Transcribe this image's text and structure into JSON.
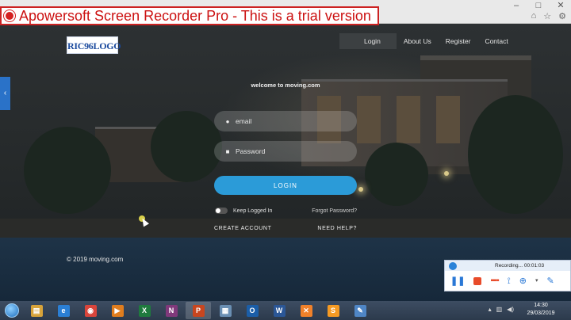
{
  "banner": {
    "text": "Apowersoft Screen Recorder Pro - This is a trial version"
  },
  "site": {
    "logo": "RIC96LOGO",
    "nav": [
      "Login",
      "About Us",
      "Register",
      "Contact"
    ],
    "welcome": "welcome to moving.com",
    "email_placeholder": "email",
    "password_placeholder": "Password",
    "login_label": "LOGIN",
    "keep_logged_in": "Keep Logged In",
    "forgot_password": "Forgot Password?",
    "create_account": "CREATE ACCOUNT",
    "need_help": "NEED HELP?",
    "copyright": "© 2019 moving.com"
  },
  "recorder": {
    "status": "Recording... 00:01:03"
  },
  "taskbar": {
    "apps": [
      {
        "name": "explorer-icon",
        "glyph": "▤",
        "color": "#d7a33a"
      },
      {
        "name": "ie-icon",
        "glyph": "e",
        "color": "#2b7fd4"
      },
      {
        "name": "chrome-icon",
        "glyph": "◉",
        "color": "#d9453b"
      },
      {
        "name": "media-player-icon",
        "glyph": "▶",
        "color": "#e07d1e"
      },
      {
        "name": "excel-icon",
        "glyph": "X",
        "color": "#1f7a3e"
      },
      {
        "name": "onenote-icon",
        "glyph": "N",
        "color": "#80397b"
      },
      {
        "name": "powerpoint-icon",
        "glyph": "P",
        "color": "#c8461f"
      },
      {
        "name": "photos-icon",
        "glyph": "▦",
        "color": "#6a8fb3"
      },
      {
        "name": "outlook-icon",
        "glyph": "O",
        "color": "#1b5ea8"
      },
      {
        "name": "word-icon",
        "glyph": "W",
        "color": "#2b5797"
      },
      {
        "name": "xampp-icon",
        "glyph": "✕",
        "color": "#f0812a"
      },
      {
        "name": "sublime-icon",
        "glyph": "S",
        "color": "#f59a23"
      },
      {
        "name": "paint-icon",
        "glyph": "✎",
        "color": "#4f86c6"
      }
    ],
    "active_index": 6,
    "time": "14:30",
    "date": "29/03/2019"
  }
}
